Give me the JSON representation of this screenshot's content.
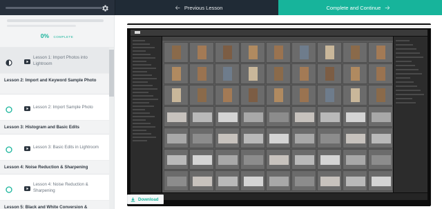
{
  "topbar": {
    "previous_label": "Previous Lesson",
    "next_label": "Complete and Continue"
  },
  "sidebar": {
    "progress": {
      "percent": "0%",
      "label": "COMPLETE"
    },
    "sections": [
      {
        "head": null,
        "lessons": [
          {
            "title": "Lesson 1: Import Photos into Lightroom",
            "status": "in-progress",
            "active": true
          }
        ]
      },
      {
        "head": "Lesson 2: Import and Keyword Sample Photo",
        "lessons": [
          {
            "title": "Lesson 2: Import Sample Photo",
            "status": "not-started",
            "active": false
          }
        ]
      },
      {
        "head": "Lesson 3: Histogram and Basic Edits",
        "lessons": [
          {
            "title": "Lesson 3: Basic Edits in Lightroom",
            "status": "not-started",
            "active": false
          }
        ]
      },
      {
        "head": "Lesson 4: Noise Reduction & Sharpening",
        "lessons": [
          {
            "title": "Lesson 4: Noise Reduction & Sharpening",
            "status": "not-started",
            "active": false
          }
        ]
      },
      {
        "head": "Lesson 5: Black and White Conversion &",
        "lessons": []
      }
    ]
  },
  "main": {
    "download_label": "Download"
  },
  "colors": {
    "accent": "#17b49b",
    "dark": "#202b36",
    "sidebar_bg": "#f2f3f4"
  },
  "icons": {
    "gear": "gear-icon",
    "prev": "arrow-left-icon",
    "next": "arrow-right-icon",
    "play": "video-play-icon",
    "half": "half-circle-icon",
    "ring": "empty-circle-icon",
    "download": "download-icon"
  }
}
